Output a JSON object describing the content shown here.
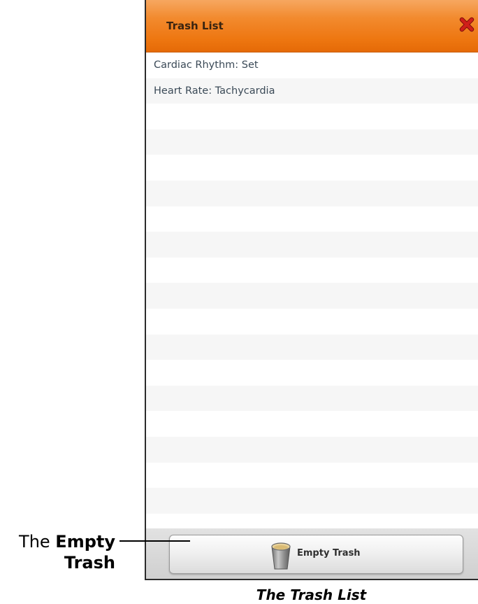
{
  "trash_list": {
    "title": "Trash List",
    "close_icon": "close-x-icon",
    "accent_color": "#ee7711",
    "close_color": "#d0201a",
    "items": [
      "Cardiac Rhythm: Set",
      "Heart Rate: Tachycardia",
      "",
      "",
      "",
      "",
      "",
      "",
      "",
      "",
      "",
      "",
      "",
      "",
      "",
      "",
      "",
      ""
    ],
    "empty_button": {
      "label": "Empty Trash",
      "icon": "trash-can-icon"
    }
  },
  "callout": {
    "prefix": "The ",
    "bold_line1": "Empty",
    "bold_line2": "Trash"
  },
  "caption": "The Trash List"
}
